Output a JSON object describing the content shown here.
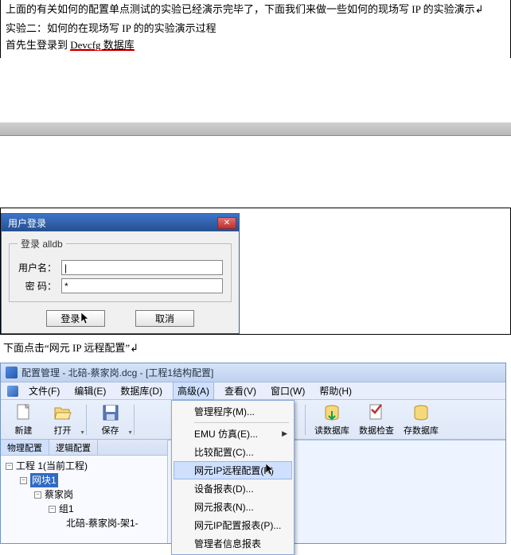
{
  "doc": {
    "line1a": "上面的有关如何的配置单点测试的实验已经演示完毕了，下面我们来做一些如何的现场写 IP 的实验演示",
    "arrow": "↲",
    "line2": "实验二：如何的在现场写 IP 的的实验演示过程",
    "line3a": "首先生登录到 ",
    "line3b": "Devcfg 数据库"
  },
  "login": {
    "title": "用户登录",
    "legend": "登录 alldb",
    "user_label": "用户名：",
    "user_value": "|",
    "pass_label": "密  码：",
    "pass_value": "*",
    "ok_label": "登录",
    "cancel_label": "取消"
  },
  "mid_text": "下面点击“网元 IP 远程配置”↲",
  "cfg": {
    "title": "配置管理 - 北碚-蔡家岗.dcg - [工程1结构配置]",
    "menu": {
      "file": "文件(F)",
      "edit": "编辑(E)",
      "db": "数据库(D)",
      "adv": "高级(A)",
      "view": "查看(V)",
      "win": "窗口(W)",
      "help": "帮助(H)"
    },
    "toolbar": {
      "new": "新建",
      "open": "打开",
      "save": "保存",
      "read_db": "读数据库",
      "check": "数据检查",
      "save_db": "存数据库"
    },
    "dropdown": {
      "mgmt": "管理程序(M)...",
      "emu": "EMU 仿真(E)...",
      "compare": "比较配置(C)...",
      "remote": "网元IP远程配置(R)",
      "devrpt": "设备报表(D)...",
      "nerpt": "网元报表(N)...",
      "iprpt": "网元IP配置报表(P)...",
      "admin": "管理者信息报表"
    },
    "tabs": {
      "phys": "物理配置",
      "logic": "逻辑配置"
    },
    "tree": {
      "proj": "工程 1(当前工程)",
      "block": "网块1",
      "site": "蔡家岗",
      "grp": "组1",
      "leaf": "北碚-蔡家岗-架1-"
    }
  }
}
